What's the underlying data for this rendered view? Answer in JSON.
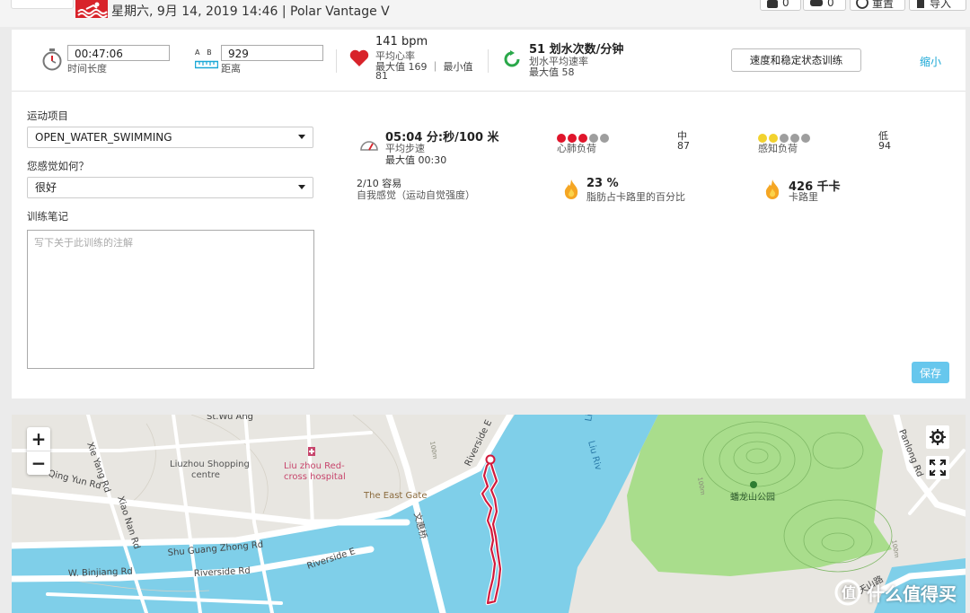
{
  "header": {
    "title": "星期六, 9月 14, 2019 14:46 | Polar Vantage V",
    "btn_a_count": "0",
    "btn_b_count": "0",
    "overlay_label": "重置",
    "export_label": "导入"
  },
  "summary": {
    "duration_value": "00:47:06",
    "duration_label": "时间长度",
    "distance_ab": "A   B",
    "distance_value": "929",
    "distance_label": "距离",
    "hr_value": "141 bpm",
    "hr_label": "平均心率",
    "hr_max_min": "最大值 169 ｜ 最小值",
    "hr_min_value": "81",
    "stroke_value": "51 划水次数/分钟",
    "stroke_label": "划水平均速率",
    "stroke_max": "最大值 58",
    "training_button": "速度和稳定状态训练",
    "collapse_link": "缩小"
  },
  "form": {
    "sport_label": "运动项目",
    "sport_value": "OPEN_WATER_SWIMMING",
    "feel_label": "您感觉如何？",
    "feel_value": "很好",
    "notes_label": "训练笔记",
    "notes_placeholder": "写下关于此训练的注解"
  },
  "stats": {
    "pace_value": "05:04 分:秒/100 米",
    "pace_label": "平均步速",
    "pace_max": "最大值 00:30",
    "cardio_label": "心肺负荷",
    "cardio_level": "中",
    "cardio_value": "87",
    "cardio_dots_filled": 3,
    "perceived_label": "感知负荷",
    "perceived_level": "低",
    "perceived_value": "94",
    "perceived_dots_filled": 2,
    "rpe_value": "2/10 容易",
    "rpe_label": "自我感觉（运动自觉强度）",
    "fat_value": "23 %",
    "fat_label": "脂肪占卡路里的百分比",
    "kcal_value": "426 千卡",
    "kcal_label": "卡路里"
  },
  "save_label": "保存",
  "map": {
    "zoom_in": "+",
    "zoom_out": "−",
    "labels": {
      "xiyang": "Xie Yang Rd",
      "qingyun": "Qing Yun Rd",
      "xiaonan": "Xiao Nan Rd",
      "stwu": "St.Wu Ang",
      "shopping1": "Liuzhou Shopping",
      "shopping2": "centre",
      "hospital1": "Liu zhou Red-",
      "hospital2": "cross hospital",
      "eastgate": "The East Gate",
      "shuguang": "Shu Guang Zhong Rd",
      "binjiang": "W. Binjiang Rd",
      "riverside": "Riverside Rd",
      "riversidee": "Riverside E",
      "riversidee2": "Riverside E",
      "wenhuiqiao": "文惠桥",
      "liuriver": "Liu River",
      "liuriver2": "Liu Riv",
      "park": "蟠龙山公园",
      "panlong": "Panlong Rd",
      "tianshan": "天山路",
      "c100a": "100m",
      "c100b": "100m",
      "c100c": "100m"
    },
    "watermark": "什么值得买"
  }
}
